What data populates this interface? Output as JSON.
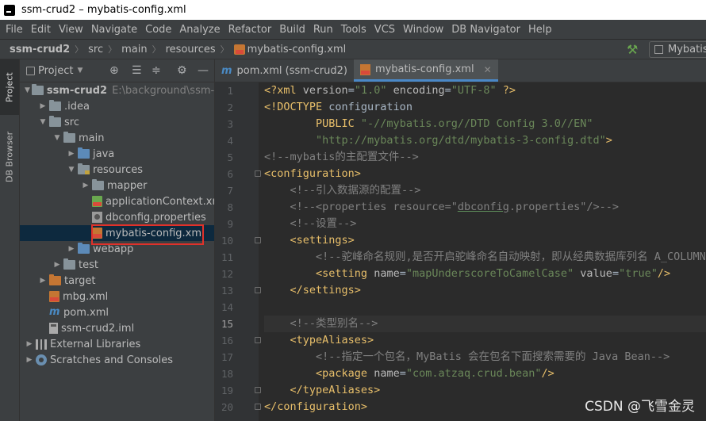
{
  "window": {
    "title": "ssm-crud2 – mybatis-config.xml"
  },
  "menu": [
    "File",
    "Edit",
    "View",
    "Navigate",
    "Code",
    "Analyze",
    "Refactor",
    "Build",
    "Run",
    "Tools",
    "VCS",
    "Window",
    "DB Navigator",
    "Help"
  ],
  "breadcrumbs": [
    "ssm-crud2",
    "src",
    "main",
    "resources",
    "mybatis-config.xml"
  ],
  "run_config": {
    "label": "Mybatis"
  },
  "left_toolbar": {
    "project_tab": "Project",
    "db_tab": "DB Browser"
  },
  "project_panel": {
    "title": "Project",
    "tree": [
      {
        "label": "ssm-crud2",
        "path": "E:\\background\\ssm-cru",
        "icon": "folder-icon",
        "expanded": true,
        "depth": 0
      },
      {
        "label": ".idea",
        "icon": "folder-icon",
        "expanded": false,
        "depth": 1
      },
      {
        "label": "src",
        "icon": "folder-icon",
        "expanded": true,
        "depth": 1
      },
      {
        "label": "main",
        "icon": "folder-icon",
        "expanded": true,
        "depth": 2
      },
      {
        "label": "java",
        "icon": "source-folder-icon",
        "expanded": false,
        "depth": 3
      },
      {
        "label": "resources",
        "icon": "resources-folder-icon",
        "expanded": true,
        "depth": 3
      },
      {
        "label": "mapper",
        "icon": "folder-icon",
        "expanded": false,
        "depth": 4
      },
      {
        "label": "applicationContext.xml",
        "icon": "spring-xml-icon",
        "depth": 4
      },
      {
        "label": "dbconfig.properties",
        "icon": "properties-icon",
        "depth": 4
      },
      {
        "label": "mybatis-config.xml",
        "icon": "xml-icon",
        "depth": 4,
        "selected": true
      },
      {
        "label": "webapp",
        "icon": "web-folder-icon",
        "expanded": false,
        "depth": 3
      },
      {
        "label": "test",
        "icon": "folder-icon",
        "expanded": false,
        "depth": 2
      },
      {
        "label": "target",
        "icon": "excluded-folder-icon",
        "expanded": false,
        "depth": 1
      },
      {
        "label": "mbg.xml",
        "icon": "xml-icon",
        "depth": 1
      },
      {
        "label": "pom.xml",
        "icon": "maven-icon",
        "depth": 1
      },
      {
        "label": "ssm-crud2.iml",
        "icon": "iml-icon",
        "depth": 1
      },
      {
        "label": "External Libraries",
        "icon": "libraries-icon",
        "expanded": false,
        "depth": 0
      },
      {
        "label": "Scratches and Consoles",
        "icon": "scratches-icon",
        "expanded": false,
        "depth": 0
      }
    ]
  },
  "tabs": [
    {
      "label": "pom.xml (ssm-crud2)",
      "icon": "maven-icon",
      "active": false
    },
    {
      "label": "mybatis-config.xml",
      "icon": "xml-icon",
      "active": true
    }
  ],
  "editor": {
    "current_line": 15,
    "lines": [
      {
        "n": "1"
      },
      {
        "n": "2"
      },
      {
        "n": "3"
      },
      {
        "n": "4"
      },
      {
        "n": "5"
      },
      {
        "n": "6"
      },
      {
        "n": "7"
      },
      {
        "n": "8"
      },
      {
        "n": "9"
      },
      {
        "n": "10"
      },
      {
        "n": "11"
      },
      {
        "n": "12"
      },
      {
        "n": "13"
      },
      {
        "n": "14"
      },
      {
        "n": "15"
      },
      {
        "n": "16"
      },
      {
        "n": "17"
      },
      {
        "n": "18"
      },
      {
        "n": "19"
      },
      {
        "n": "20"
      }
    ],
    "code": {
      "l1": {
        "a": "<?xml ",
        "b": "version",
        "c": "=",
        "d": "\"1.0\"",
        "e": " encoding",
        "f": "=",
        "g": "\"UTF-8\"",
        "h": " ?>"
      },
      "l2": {
        "a": "<!DOCTYPE ",
        "b": "configuration"
      },
      "l3": {
        "a": "        PUBLIC ",
        "b": "\"-//mybatis.org//DTD Config 3.0//EN\""
      },
      "l4": {
        "a": "        ",
        "b": "\"http://mybatis.org/dtd/mybatis-3-config.dtd\"",
        "c": ">"
      },
      "l5": {
        "a": "<!--mybatis的主配置文件-->"
      },
      "l6": {
        "a": "<configuration>"
      },
      "l7": {
        "a": "    <!--引入数据源的配置-->"
      },
      "l8": {
        "a": "    <!--<properties resource=\"",
        "b": "dbconfig",
        "c": ".properties\"/>-->"
      },
      "l9": {
        "a": "    <!--设置-->"
      },
      "l10": {
        "a": "    ",
        "b": "<settings>"
      },
      "l11": {
        "a": "        <!--驼峰命名规则,是否开启驼峰命名自动映射，即从经典数据库列名 A_COLUMN 映射"
      },
      "l12": {
        "a": "        ",
        "b": "<setting ",
        "c": "name",
        "d": "=",
        "e": "\"mapUnderscoreToCamelCase\"",
        "f": " value",
        "g": "=",
        "h": "\"true\"",
        "i": "/>"
      },
      "l13": {
        "a": "    ",
        "b": "</settings>"
      },
      "l14": {
        "a": ""
      },
      "l15": {
        "a": "    <!--类型别名-->"
      },
      "l16": {
        "a": "    ",
        "b": "<typeAliases>"
      },
      "l17": {
        "a": "        <!--指定一个包名，MyBatis 会在包名下面搜索需要的 Java Bean-->"
      },
      "l18": {
        "a": "        ",
        "b": "<package ",
        "c": "name",
        "d": "=",
        "e": "\"com.atzaq.crud.bean\"",
        "f": "/>"
      },
      "l19": {
        "a": "    ",
        "b": "</typeAliases>"
      },
      "l20": {
        "a": "</configuration>"
      }
    }
  },
  "watermark": "CSDN @飞雪金灵"
}
